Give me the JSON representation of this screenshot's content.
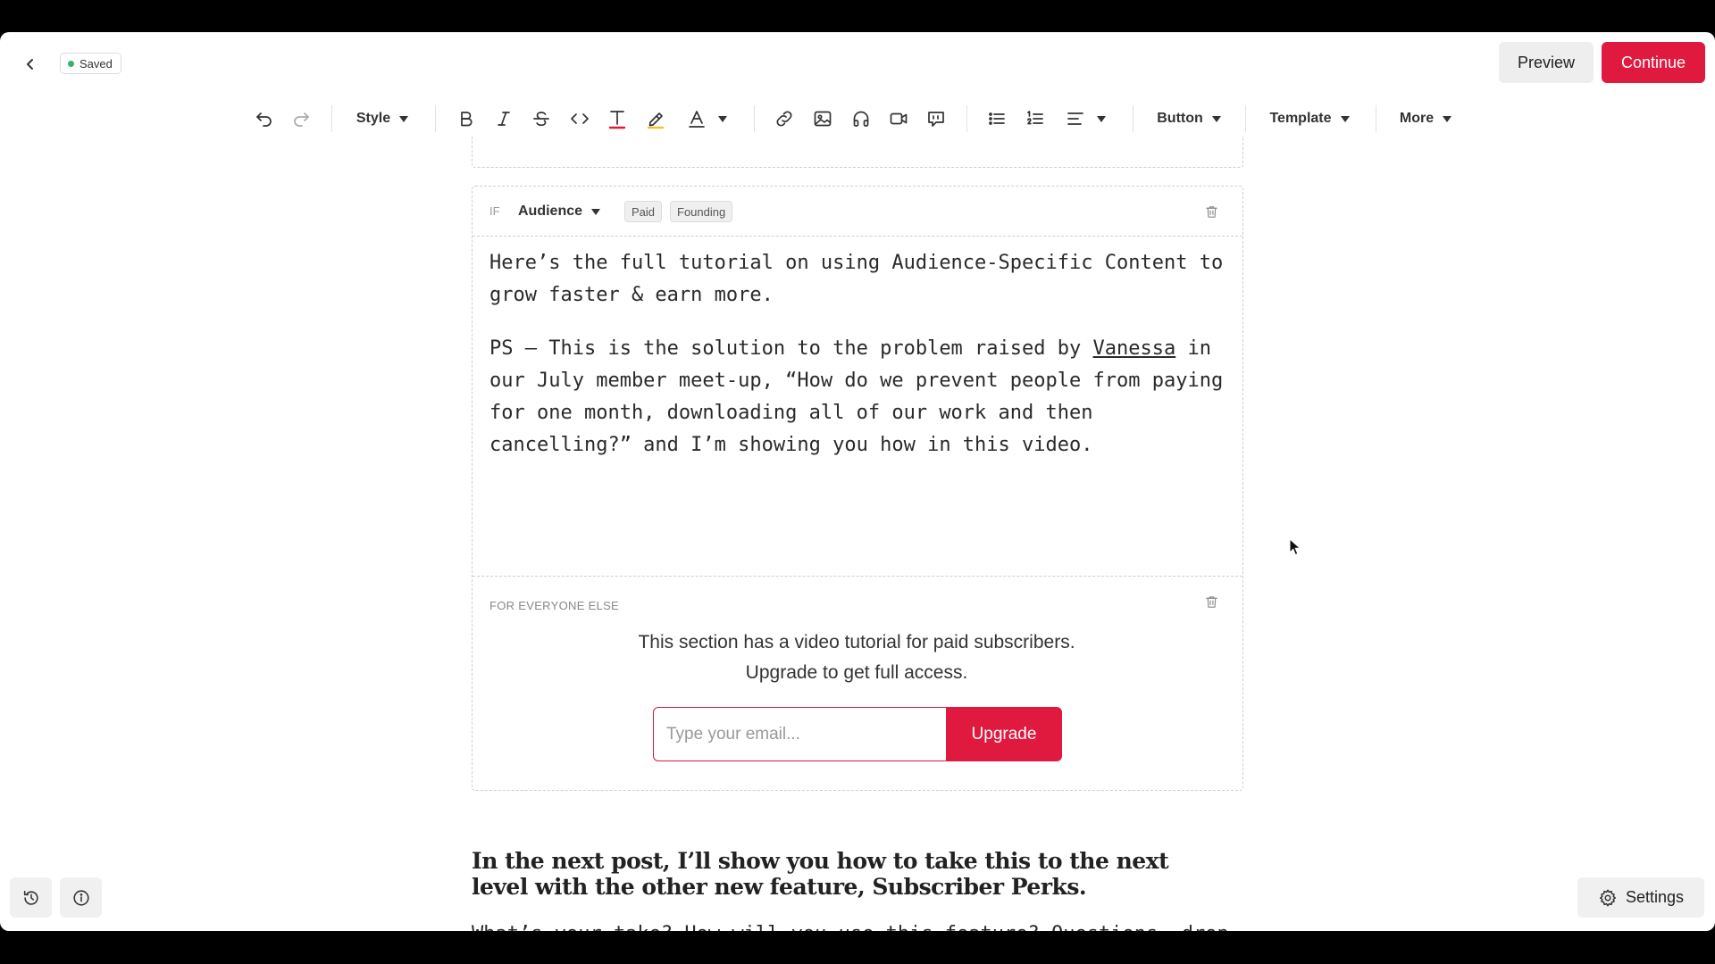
{
  "header": {
    "saved_label": "Saved",
    "preview_label": "Preview",
    "continue_label": "Continue"
  },
  "toolbar": {
    "style_label": "Style",
    "button_label": "Button",
    "template_label": "Template",
    "more_label": "More",
    "icons": [
      "undo-icon",
      "redo-icon",
      "bold-icon",
      "italic-icon",
      "strikethrough-icon",
      "code-icon",
      "text-color-icon",
      "highlight-icon",
      "font-color-icon",
      "link-icon",
      "image-icon",
      "audio-icon",
      "video-icon",
      "quote-icon",
      "bullet-list-icon",
      "numbered-list-icon",
      "align-icon"
    ]
  },
  "condition_block": {
    "if_label": "IF",
    "audience_label": "Audience",
    "tags": [
      "Paid",
      "Founding"
    ],
    "paragraph1": "Here’s the full tutorial on using Audience-Specific Content to grow faster & earn more.",
    "paragraph2_before": "PS — This is the solution to the problem raised by ",
    "paragraph2_link": "Vanessa",
    "paragraph2_after": " in our July member meet-up, “How do we prevent people from paying for one month, downloading all of our work and then cancelling?” and I’m showing you how in this video.",
    "else_label": "FOR EVERYONE ELSE",
    "paywall_text": "This section has a video tutorial for paid subscribers. Upgrade to get full access.",
    "email_placeholder": "Type your email...",
    "upgrade_label": "Upgrade"
  },
  "after": {
    "heading": "In the next post, I’ll show you how to take this to the next level with the other new feature, Subscriber Perks.",
    "paragraph": "What’s your take? How will you use this feature? Questions, drop them below."
  },
  "footer": {
    "settings_label": "Settings"
  },
  "colors": {
    "accent": "#e0193f",
    "saved_dot": "#2fb46a",
    "text_color_underline": "#e0193f",
    "highlight_underline": "#f2c12e"
  }
}
